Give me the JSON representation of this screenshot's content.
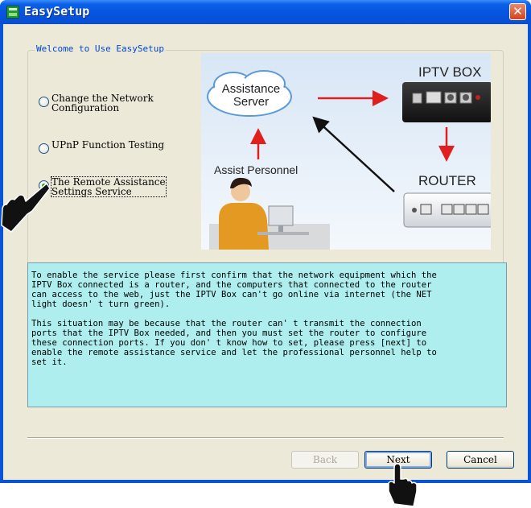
{
  "window": {
    "title": "EasySetup",
    "close_glyph": "✕"
  },
  "group": {
    "legend": "Welcome to Use EasySetup"
  },
  "options": [
    {
      "label": "Change the Network\nConfiguration",
      "checked": false
    },
    {
      "label": "UPnP Function Testing",
      "checked": false
    },
    {
      "label": "The Remote Assistance\nSettings Service",
      "checked": true
    }
  ],
  "illustration": {
    "assistance_server": "Assistance\nServer",
    "iptv_box": "IPTV BOX",
    "assist_personnel": "Assist Personnel",
    "router": "ROUTER"
  },
  "info": {
    "text": "To enable the service please first confirm that the network equipment which the\nIPTV Box connected is a router, and the computers that connected to the router\ncan access to the web, just the IPTV Box can't go online via internet (the NET\nlight doesn' t turn green).\n\nThis situation may be because that the router can' t transmit the connection\nports that the IPTV Box needed, and then you must set the router to configure\nthese connection ports. If you don' t know how to set, please press [next] to\nenable the remote assistance service and let the professional personnel help to\nset it."
  },
  "buttons": {
    "back": "Back",
    "next": "Next",
    "cancel": "Cancel"
  },
  "colors": {
    "titlebar": "#0553e0",
    "legend": "#0046d5",
    "info_bg": "#aeeeee",
    "arrow_red": "#e0201e"
  }
}
